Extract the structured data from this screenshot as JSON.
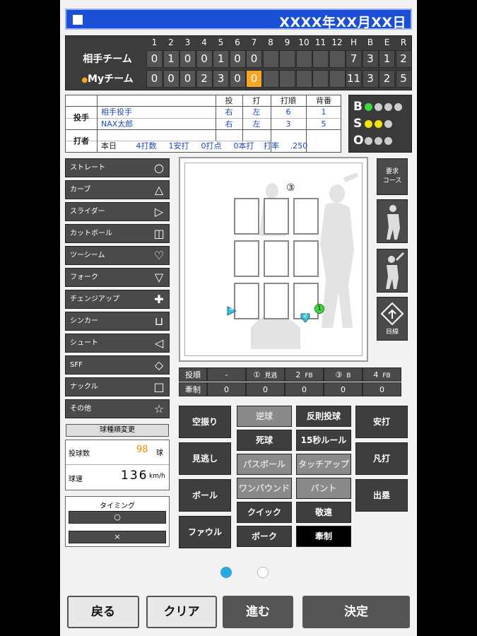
{
  "header": {
    "date": "XXXX年XX月XX日"
  },
  "scoreboard": {
    "innings": [
      "1",
      "2",
      "3",
      "4",
      "5",
      "6",
      "7",
      "8",
      "9",
      "10",
      "11",
      "12",
      "H",
      "B",
      "E",
      "R"
    ],
    "rows": [
      {
        "team": "相手チーム",
        "scores": [
          "0",
          "1",
          "0",
          "0",
          "1",
          "0",
          "0",
          "",
          "",
          "",
          "",
          "",
          "7",
          "3",
          "1",
          "2"
        ]
      },
      {
        "team": "Myチーム",
        "marker": "●",
        "scores": [
          "0",
          "0",
          "0",
          "2",
          "3",
          "0",
          "0",
          "",
          "",
          "",
          "",
          "",
          "11",
          "3",
          "2",
          "5"
        ]
      }
    ],
    "highlight_color": "#f5a623"
  },
  "info": {
    "col_headers": [
      "投",
      "打",
      "打順",
      "背番"
    ],
    "pitcher_label": "投手",
    "pitcher_name": "相手投手",
    "pitcher_vals": [
      "右",
      "左",
      "6",
      "1"
    ],
    "batter_label": "打者",
    "batter_name": "NAX太郎",
    "batter_vals": [
      "右",
      "左",
      "3",
      "5"
    ],
    "today_label": "本日",
    "today_stats": [
      "4打数",
      "1安打",
      "0打点",
      "0本打",
      "打率",
      ".250"
    ]
  },
  "bso": {
    "labels": [
      "B",
      "S",
      "O"
    ],
    "counts": [
      1,
      2,
      0
    ],
    "colors": {
      "B": "#3fd83f",
      "S": "#f2e600",
      "O": "#ccc"
    }
  },
  "pitches": [
    {
      "label": "ストレート",
      "icon": "○"
    },
    {
      "label": "カーブ",
      "icon": "△"
    },
    {
      "label": "スライダー",
      "icon": "▷"
    },
    {
      "label": "カットボール",
      "icon": "◫"
    },
    {
      "label": "ツーシーム",
      "icon": "♡"
    },
    {
      "label": "フォーク",
      "icon": "▽"
    },
    {
      "label": "チェンジアップ",
      "icon": "✚"
    },
    {
      "label": "シンカー",
      "icon": "⊔"
    },
    {
      "label": "シュート",
      "icon": "◁"
    },
    {
      "label": "SFF",
      "icon": "◇"
    },
    {
      "label": "ナックル",
      "icon": "□"
    },
    {
      "label": "その他",
      "icon": "☆"
    }
  ],
  "zone": {
    "top_marker": "③",
    "marks": [
      {
        "n": "4"
      },
      {
        "n": "2"
      },
      {
        "n": "1"
      }
    ]
  },
  "right_icons": {
    "course": "要求\nコース",
    "sight": "目線"
  },
  "log": {
    "row1_label": "投順",
    "row1": [
      "-",
      "①",
      "見逃",
      "2",
      "FB",
      "③",
      "B",
      "4",
      "FB"
    ],
    "row2_label": "牽制",
    "row2": [
      "0",
      "0",
      "0",
      "0",
      "0"
    ]
  },
  "left_panel": {
    "change_order": "球種順変更",
    "pitch_count_label": "投球数",
    "pitch_count": "98",
    "pitch_count_unit": "球",
    "speed_label": "球速",
    "speed": "136",
    "speed_unit": "km/h",
    "timing_label": "タイミング",
    "timing_ok": "○",
    "timing_ng": "×"
  },
  "actions": {
    "col1": [
      "空振り",
      "見逃し",
      "ボール",
      "ファウル"
    ],
    "col2": [
      "逆球",
      "死球",
      "パスボール",
      "ワンバウンド",
      "クイック",
      "ボーク"
    ],
    "col3": [
      "反則投球",
      "15秒ルール",
      "タッチアップ",
      "バント",
      "敬遠",
      "牽制"
    ],
    "col4": [
      "安打",
      "凡打",
      "出塁"
    ]
  },
  "footer": {
    "back": "戻る",
    "clear": "クリア",
    "next": "進む",
    "confirm": "決定"
  },
  "page_dots": {
    "active_color": "#29a9e0"
  }
}
